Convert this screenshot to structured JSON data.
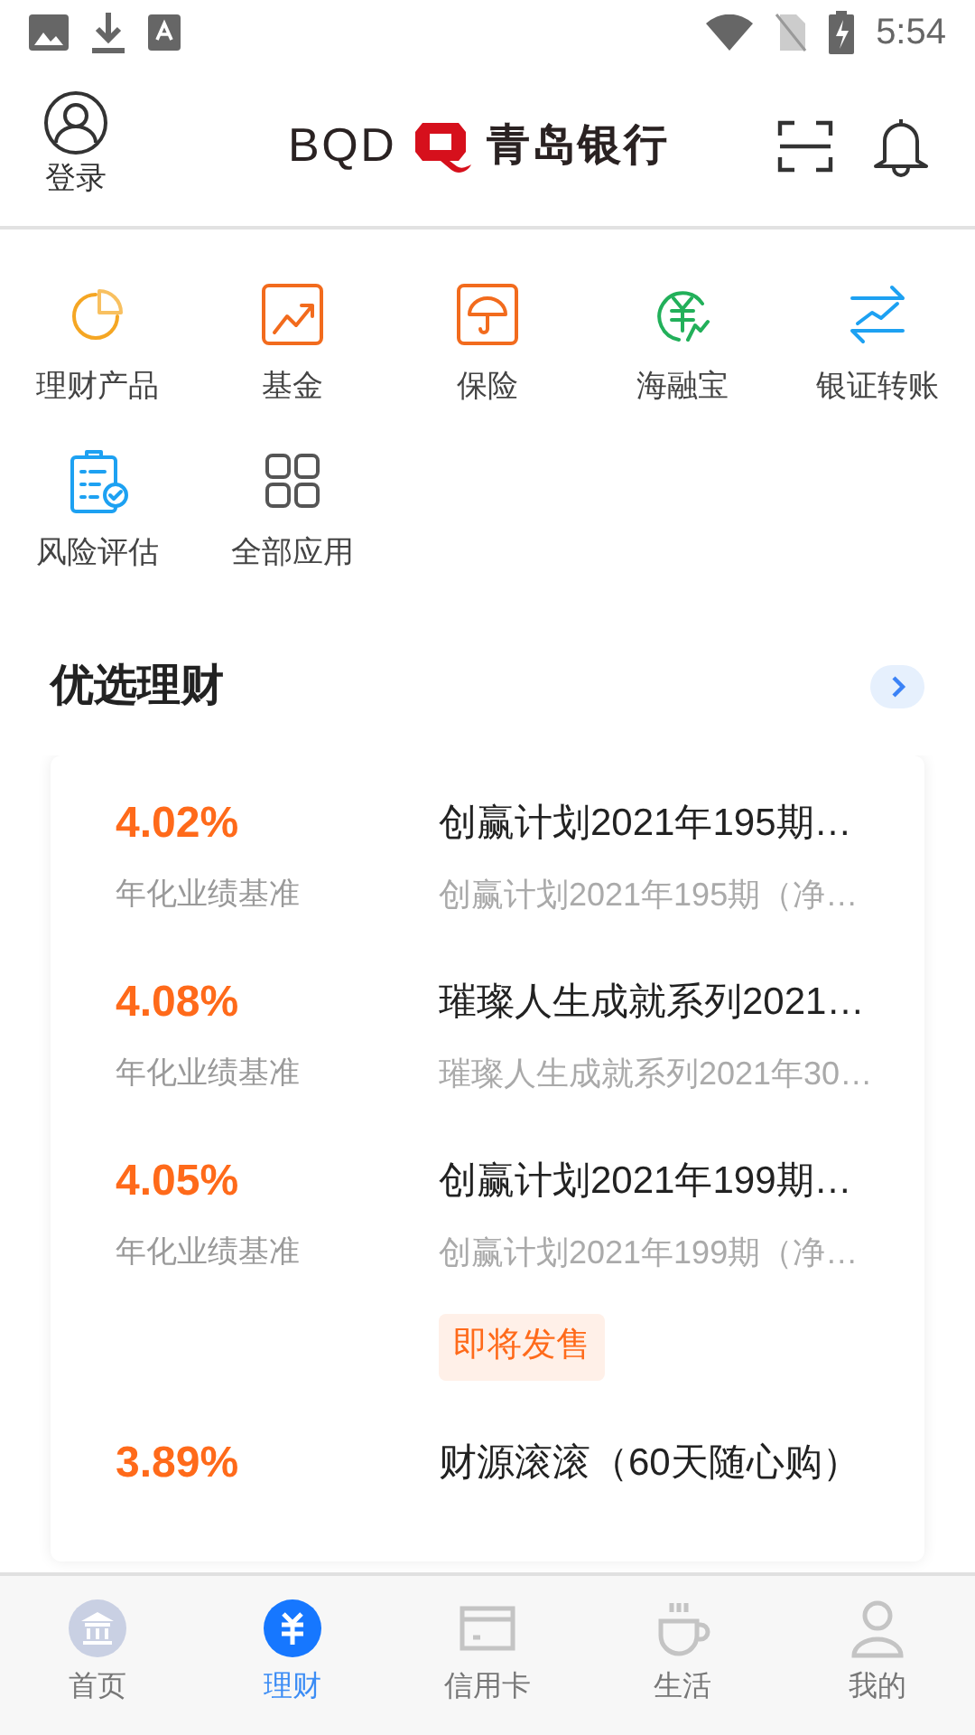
{
  "status_bar": {
    "time": "5:54"
  },
  "header": {
    "login_label": "登录",
    "logo_latin": "BQD",
    "logo_name": "青岛银行"
  },
  "shortcuts": [
    {
      "label": "理财产品"
    },
    {
      "label": "基金"
    },
    {
      "label": "保险"
    },
    {
      "label": "海融宝"
    },
    {
      "label": "银证转账"
    },
    {
      "label": "风险评估"
    },
    {
      "label": "全部应用"
    }
  ],
  "section": {
    "title": "优选理财"
  },
  "products": [
    {
      "rate": "4.02%",
      "rate_label": "年化业绩基准",
      "title": "创赢计划2021年195期…",
      "subtitle": "创赢计划2021年195期（净…"
    },
    {
      "rate": "4.08%",
      "rate_label": "年化业绩基准",
      "title": "璀璨人生成就系列2021…",
      "subtitle": "璀璨人生成就系列2021年30…"
    },
    {
      "rate": "4.05%",
      "rate_label": "年化业绩基准",
      "title": "创赢计划2021年199期…",
      "subtitle": "创赢计划2021年199期（净…",
      "tag": "即将发售"
    },
    {
      "rate": "3.89%",
      "title": "财源滚滚（60天随心购）"
    }
  ],
  "bottom_nav": [
    {
      "label": "首页",
      "selected": false
    },
    {
      "label": "理财",
      "selected": true
    },
    {
      "label": "信用卡",
      "selected": false
    },
    {
      "label": "生活",
      "selected": false
    },
    {
      "label": "我的",
      "selected": false
    }
  ]
}
